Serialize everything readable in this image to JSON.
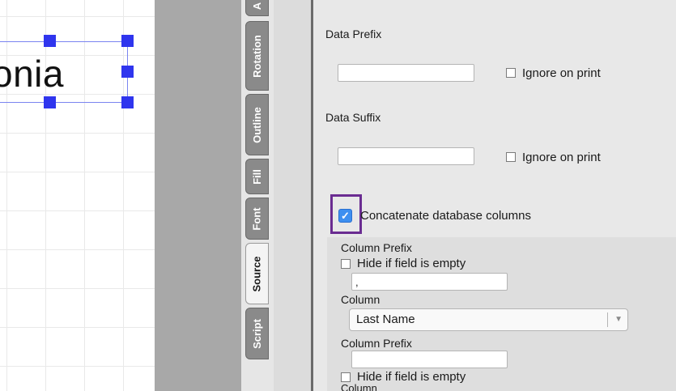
{
  "canvas": {
    "text_object": "onia"
  },
  "tabs": [
    {
      "label": "A",
      "active": false
    },
    {
      "label": "Rotation",
      "active": false
    },
    {
      "label": "Outline",
      "active": false
    },
    {
      "label": "Fill",
      "active": false
    },
    {
      "label": "Font",
      "active": false
    },
    {
      "label": "Source",
      "active": true
    },
    {
      "label": "Script",
      "active": false
    }
  ],
  "panel": {
    "data_prefix_label": "Data Prefix",
    "data_prefix_value": "",
    "ignore_print_label_1": "Ignore on print",
    "data_suffix_label": "Data Suffix",
    "data_suffix_value": "",
    "ignore_print_label_2": "Ignore on print",
    "concatenate_label": "Concatenate  database columns",
    "concatenate_checkmark": "✓",
    "col_prefix_label_1": "Column Prefix",
    "hide_empty_label_1": "Hide if field is empty",
    "col_prefix_value_1": ",",
    "column_label_1": "Column",
    "column_select_value": "Last Name",
    "column_select_arrow": "▼",
    "col_prefix_label_2": "Column Prefix",
    "col_prefix_value_2": "",
    "hide_empty_label_2": "Hide if field is empty",
    "column_label_2": "Column"
  }
}
